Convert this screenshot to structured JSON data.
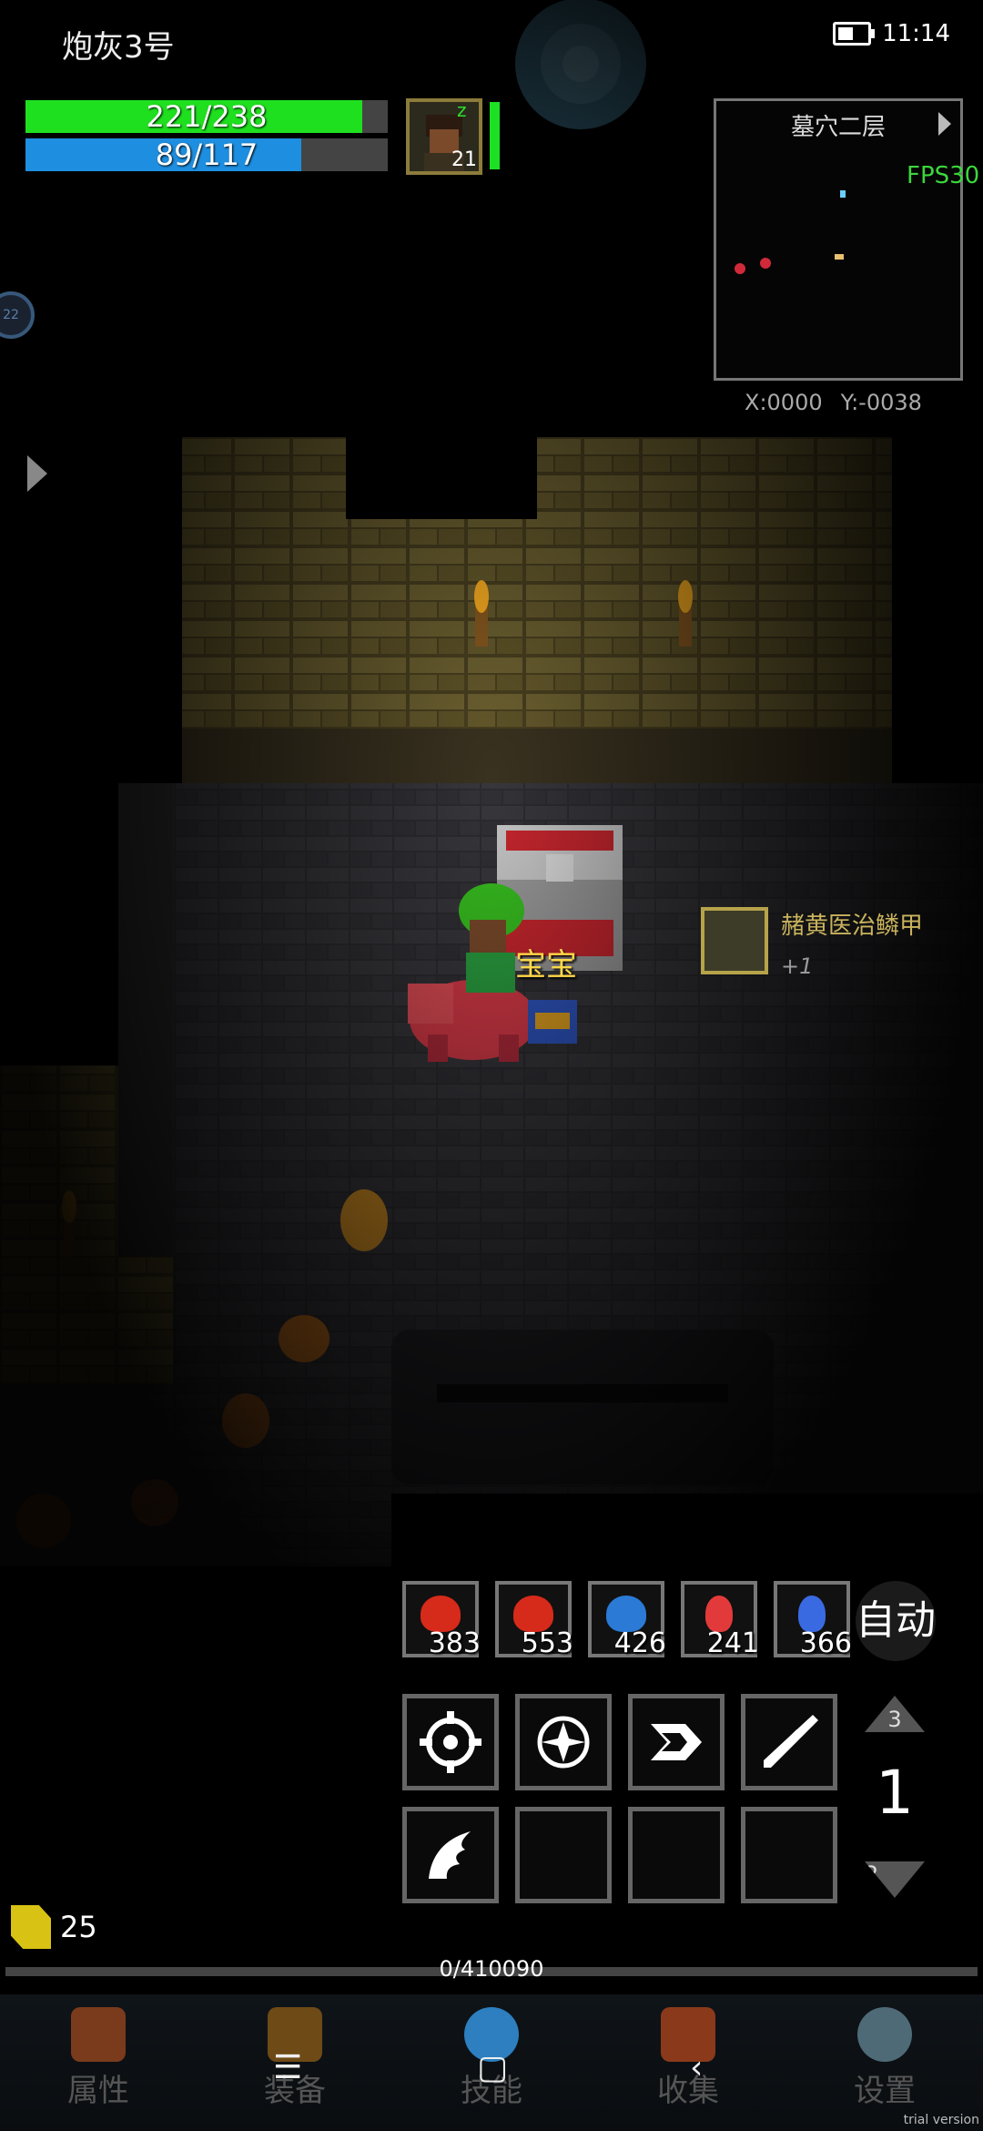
{
  "player": {
    "name": "炮灰3号",
    "level": "21"
  },
  "status_bar": {
    "time": "11:14",
    "battery_icon": "battery-icon"
  },
  "hp": {
    "text": "221/238",
    "current": 221,
    "max": 238,
    "color": "#1fe01f"
  },
  "mp": {
    "text": "89/117",
    "current": 89,
    "max": 117,
    "color": "#1e8fe0"
  },
  "minimap": {
    "title": "墓穴二层",
    "fps": "FPS30"
  },
  "coordinates": {
    "x": "X:0000",
    "y": "Y:-0038"
  },
  "side_badge": "22",
  "loot": {
    "name": "赭黄医治鳞甲",
    "enchant": "+1"
  },
  "pet_label": "宝宝",
  "consumables": [
    {
      "icon": "red-meat-icon",
      "count": "383",
      "color": "#d62a1a"
    },
    {
      "icon": "red-meat-icon",
      "count": "553",
      "color": "#d62a1a"
    },
    {
      "icon": "blue-meat-icon",
      "count": "426",
      "color": "#2a7ad6"
    },
    {
      "icon": "red-potion-icon",
      "count": "241",
      "color": "#e23a3a"
    },
    {
      "icon": "blue-potion-icon",
      "count": "366",
      "color": "#3a6ae2"
    }
  ],
  "auto_button": "自动",
  "skills": [
    {
      "icon": "target-skill-icon"
    },
    {
      "icon": "burst-skill-icon"
    },
    {
      "icon": "dash-skill-icon"
    },
    {
      "icon": "slash-skill-icon"
    },
    {
      "icon": "wing-skill-icon"
    },
    {
      "icon": ""
    },
    {
      "icon": ""
    },
    {
      "icon": ""
    }
  ],
  "skill_page": {
    "up": "3",
    "current": "1",
    "down": "2"
  },
  "gold": {
    "value": "25"
  },
  "experience": {
    "text": "0/410090",
    "current": 0,
    "max": 410090
  },
  "nav": [
    {
      "label": "属性",
      "icon": "helmet-icon",
      "color": "#7a3b1c"
    },
    {
      "label": "装备",
      "icon": "bag-icon",
      "color": "#6e4a16"
    },
    {
      "label": "技能",
      "icon": "skill-orb-icon",
      "color": "#2d7fbf"
    },
    {
      "label": "收集",
      "icon": "book-icon",
      "color": "#8a3a1a"
    },
    {
      "label": "设置",
      "icon": "gear-icon",
      "color": "#4f6a77"
    }
  ],
  "system_nav": {
    "menu": "☰",
    "home": "▢",
    "back": "‹"
  },
  "watermark": "trial version"
}
